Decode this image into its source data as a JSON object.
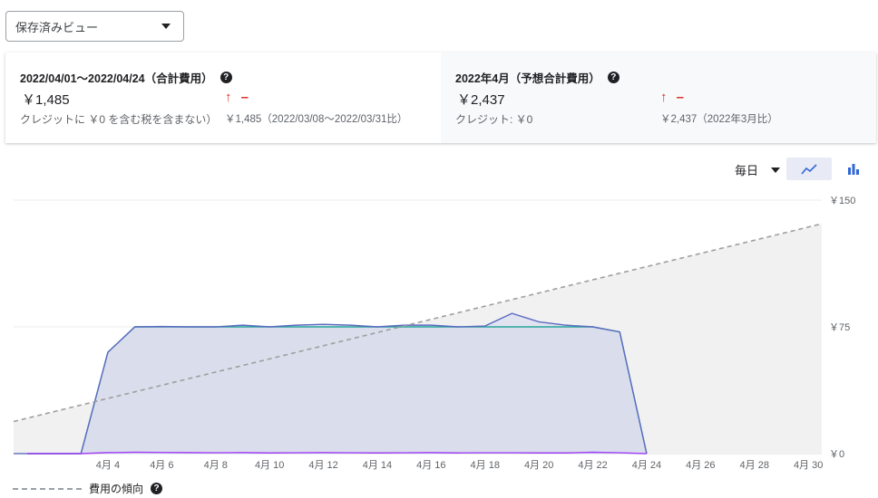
{
  "saved_view": {
    "label": "保存済みビュー"
  },
  "summary": {
    "current": {
      "title": "2022/04/01～2022/04/24（合計費用）",
      "amount": "￥1,485",
      "credit": "クレジットに ￥0 を含む税を含まない）",
      "trend_arrow": "↑",
      "trend_value": "–",
      "compare": "￥1,485（2022/03/08～2022/03/31比）"
    },
    "forecast": {
      "title": "2022年4月（予想合計費用）",
      "amount": "￥2,437",
      "credit": "クレジット: ￥0",
      "trend_arrow": "↑",
      "trend_value": "–",
      "compare": "￥2,437（2022年3月比）"
    }
  },
  "controls": {
    "granularity": "毎日"
  },
  "legend": {
    "trend_label": "費用の傾向"
  },
  "colors": {
    "accent": "#3367d6",
    "trend_red": "#d93025",
    "area_fill": "#e8eaf6"
  },
  "chart_data": {
    "type": "area",
    "x_start_day": 1,
    "x_end_day": 30,
    "x_ticks": [
      "4月 4",
      "4月 6",
      "4月 8",
      "4月 10",
      "4月 12",
      "4月 14",
      "4月 16",
      "4月 18",
      "4月 20",
      "4月 22",
      "4月 24",
      "4月 26",
      "4月 28",
      "4月 30"
    ],
    "y_ticks": [
      "￥0",
      "￥75",
      "￥150"
    ],
    "ylim": [
      0,
      150
    ],
    "stacked_series": [
      {
        "values": [
          0,
          0,
          0,
          60,
          75,
          75,
          75,
          75,
          75,
          75,
          75,
          75,
          75,
          75,
          75,
          75,
          75,
          75,
          75,
          75,
          75,
          75,
          72,
          0
        ]
      },
      {
        "values": [
          0,
          0,
          0,
          60,
          75,
          75.2,
          75,
          75,
          76,
          75,
          76,
          76.5,
          76,
          75,
          76,
          76,
          75,
          75.5,
          83,
          78,
          76,
          75,
          72,
          0
        ]
      }
    ],
    "bottom_series": {
      "values": [
        0,
        0,
        0,
        0.6,
        0.8,
        0.7,
        0.6,
        0.5,
        0.6,
        0.4,
        0.5,
        0.6,
        0.5,
        0.4,
        0.5,
        0.6,
        0.4,
        0.5,
        0.5,
        0.4,
        0.4,
        0.8,
        0.5,
        0
      ]
    },
    "trend": {
      "from": [
        1,
        19
      ],
      "to": [
        31,
        136
      ]
    }
  }
}
